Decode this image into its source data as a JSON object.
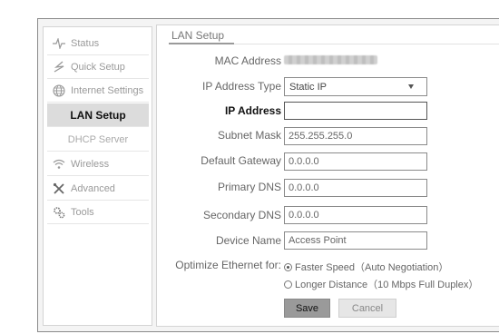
{
  "sidebar": {
    "items": [
      {
        "label": "Status",
        "icon": "pulse-icon"
      },
      {
        "label": "Quick Setup",
        "icon": "bolt-icon"
      },
      {
        "label": "Internet Settings",
        "icon": "globe-icon"
      },
      {
        "label": "LAN Setup",
        "active": true
      },
      {
        "label": "DHCP Server"
      },
      {
        "label": "Wireless",
        "icon": "wifi-icon"
      },
      {
        "label": "Advanced",
        "icon": "tools-cross-icon"
      },
      {
        "label": "Tools",
        "icon": "gears-icon"
      }
    ]
  },
  "main": {
    "tab": "LAN Setup",
    "mac_label": "MAC Address",
    "ip_type_label": "IP Address Type",
    "ip_type_value": "Static IP",
    "ip_label": "IP Address",
    "ip_value": "",
    "mask_label": "Subnet Mask",
    "mask_value": "255.255.255.0",
    "gateway_label": "Default Gateway",
    "gateway_value": "0.0.0.0",
    "dns1_label": "Primary DNS",
    "dns1_value": "0.0.0.0",
    "dns2_label": "Secondary DNS",
    "dns2_value": "0.0.0.0",
    "device_label": "Device Name",
    "device_value": "Access Point",
    "optimize_label": "Optimize Ethernet for:",
    "optimize_options": [
      {
        "label": "Faster Speed（Auto Negotiation）",
        "selected": true
      },
      {
        "label": "Longer Distance（10 Mbps Full Duplex）",
        "selected": false
      }
    ],
    "save_label": "Save",
    "cancel_label": "Cancel"
  }
}
